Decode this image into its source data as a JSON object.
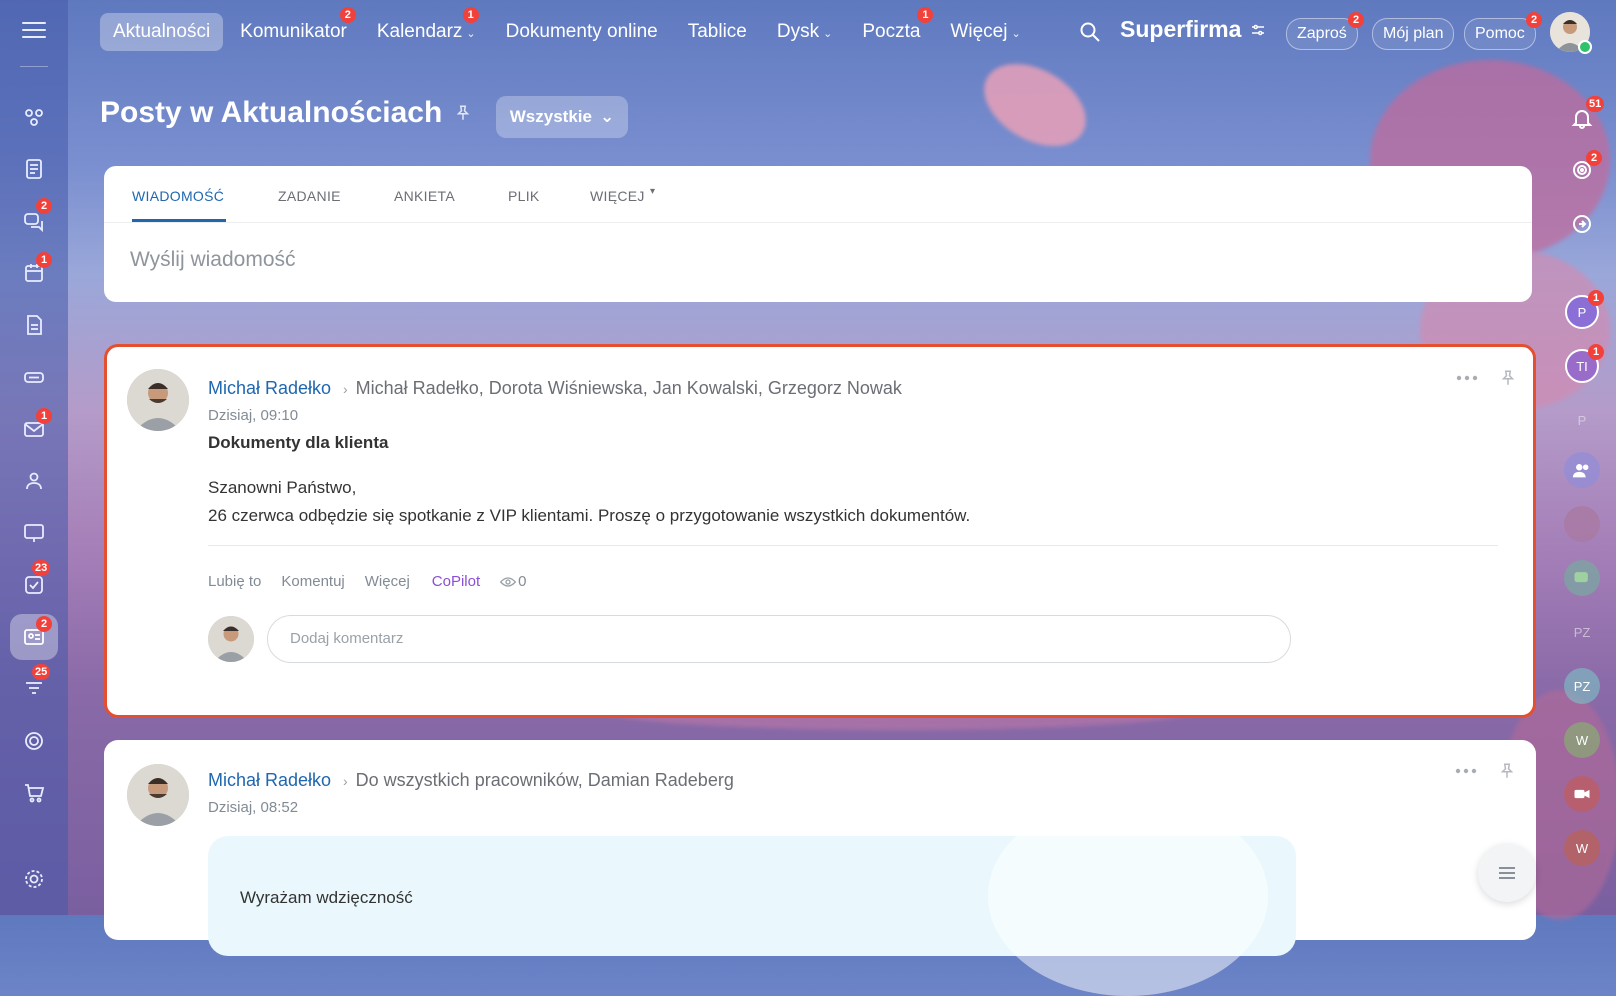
{
  "top_nav": {
    "items": [
      {
        "label": "Aktualności",
        "active": true,
        "badge": "",
        "chevron": false
      },
      {
        "label": "Komunikator",
        "active": false,
        "badge": "2",
        "chevron": false
      },
      {
        "label": "Kalendarz",
        "active": false,
        "badge": "1",
        "chevron": true
      },
      {
        "label": "Dokumenty online",
        "active": false,
        "badge": "",
        "chevron": false
      },
      {
        "label": "Tablice",
        "active": false,
        "badge": "",
        "chevron": false
      },
      {
        "label": "Dysk",
        "active": false,
        "badge": "",
        "chevron": true
      },
      {
        "label": "Poczta",
        "active": false,
        "badge": "1",
        "chevron": false
      },
      {
        "label": "Więcej",
        "active": false,
        "badge": "",
        "chevron": true
      }
    ],
    "brand": "Superfirma",
    "invite_label": "Zaproś",
    "invite_badge": "2",
    "plan_label": "Mój plan",
    "help_label": "Pomoc",
    "help_badge": "2"
  },
  "left_sidebar": {
    "badges": {
      "chats": "2",
      "calendar": "1",
      "mail": "1",
      "tasks": "23",
      "feed": "2",
      "crm": "25"
    }
  },
  "header": {
    "title": "Posty w Aktualnościach",
    "filter_label": "Wszystkie"
  },
  "compose": {
    "tabs": [
      "WIADOMOŚĆ",
      "ZADANIE",
      "ANKIETA",
      "PLIK",
      "WIĘCEJ"
    ],
    "placeholder": "Wyślij wiadomość"
  },
  "posts": [
    {
      "author": "Michał Radełko",
      "recipients": "Michał Radełko, Dorota Wiśniewska, Jan Kowalski, Grzegorz Nowak",
      "time": "Dzisiaj, 09:10",
      "title": "Dokumenty dla klienta",
      "body_line1": "Szanowni Państwo,",
      "body_line2": "26 czerwca odbędzie się spotkanie z VIP klientami. Proszę o przygotowanie wszystkich dokumentów.",
      "actions": {
        "like": "Lubię to",
        "comment": "Komentuj",
        "more": "Więcej",
        "copilot": "CoPilot",
        "views": "0"
      },
      "comment_placeholder": "Dodaj komentarz"
    },
    {
      "author": "Michał Radełko",
      "recipients": "Do wszystkich pracowników, Damian Radeberg",
      "time": "Dzisiaj, 08:52",
      "card_text": "Wyrażam wdzięczność"
    }
  ],
  "right_sidebar": {
    "notifications_badge": "51",
    "target_badge": "2",
    "chat_avatars": [
      {
        "initials": "P",
        "badge": "1",
        "color": "#8b6fd6"
      },
      {
        "initials": "TI",
        "badge": "1",
        "color": "#9a6cc9"
      },
      {
        "initials": "P",
        "badge": "",
        "color": "#b7a9d6"
      },
      {
        "initials": "PZ",
        "badge": "",
        "color": "#a98fc9"
      },
      {
        "initials": "PZ",
        "badge": "",
        "color": "#7cc3c5"
      },
      {
        "initials": "W",
        "badge": "",
        "color": "#86b86a"
      },
      {
        "initials": "W",
        "badge": "",
        "color": "#c0604a"
      }
    ]
  },
  "colors": {
    "accent_blue": "#2067b0",
    "badge_red": "#f2413a",
    "highlight_border": "#e4502f",
    "copilot_purple": "#8a4fd8"
  }
}
